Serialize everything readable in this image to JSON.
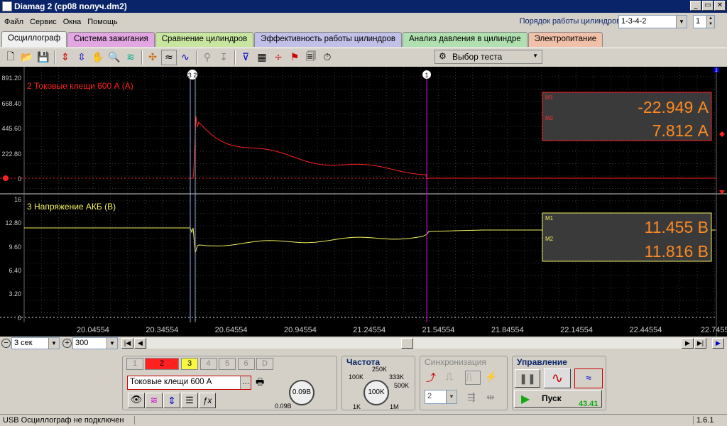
{
  "window": {
    "title": "Diamag 2 (ср08 получ.dm2)",
    "buttons": [
      "_",
      "▭",
      "✕"
    ]
  },
  "menu": [
    "Файл",
    "Сервис",
    "Окна",
    "Помощь"
  ],
  "cylinder_order": {
    "label": "Порядок работы цилиндров",
    "value": "1-3-4-2",
    "count": "1"
  },
  "tabs": [
    {
      "label": "Осциллограф",
      "color": "#f0f0f0"
    },
    {
      "label": "Система зажигания",
      "color": "#e2a6e2"
    },
    {
      "label": "Сравнение цилиндров",
      "color": "#c8e6a0"
    },
    {
      "label": "Эффективность работы цилиндров",
      "color": "#c0c0e8"
    },
    {
      "label": "Анализ давления в цилиндре",
      "color": "#b0e0b0"
    },
    {
      "label": "Электропитание",
      "color": "#f0c0a8"
    }
  ],
  "toolbar": {
    "test_select": "Выбор теста"
  },
  "channels": [
    {
      "label": "2 Токовые клещи 600 А (А)",
      "color": "#ff2020",
      "yticks": [
        "891.20",
        "668.40",
        "445.60",
        "222.80",
        "0"
      ],
      "m1": "-22.949 А",
      "m2": "7.812 А"
    },
    {
      "label": "3 Напряжение АКБ (В)",
      "color": "#f0f060",
      "yticks": [
        "16",
        "12.80",
        "9.60",
        "6.40",
        "3.20",
        "0"
      ],
      "m1": "11.455 В",
      "m2": "11.816 В"
    }
  ],
  "marker_labels": {
    "m1": "M1",
    "m2": "M2"
  },
  "time_axis": [
    "20.04554",
    "20.34554",
    "20.64554",
    "20.94554",
    "21.24554",
    "21.54554",
    "21.84554",
    "22.14554",
    "22.44554",
    "22.7455"
  ],
  "cursor_markers": {
    "left": "3 2",
    "right": "1",
    "corner": "2"
  },
  "timebase": {
    "span": "3 сек",
    "points": "300"
  },
  "channel_panel": {
    "buttons": [
      "1",
      "2",
      "3",
      "4",
      "5",
      "6",
      "D"
    ],
    "sensor": "Токовые клещи 600 А",
    "knob_value": "0.09В",
    "knob_min": "0.09В"
  },
  "frequency": {
    "title": "Частота",
    "labels": [
      "250K",
      "100K",
      "333K",
      "500K",
      "1K",
      "1M"
    ],
    "value": "100K"
  },
  "sync": {
    "title": "Синхронизация",
    "channel": "2"
  },
  "control": {
    "title": "Управление",
    "start": "Пуск",
    "value": "43.41"
  },
  "status": {
    "left": "USB Осциллограф не подключен",
    "version": "1.6.1"
  }
}
